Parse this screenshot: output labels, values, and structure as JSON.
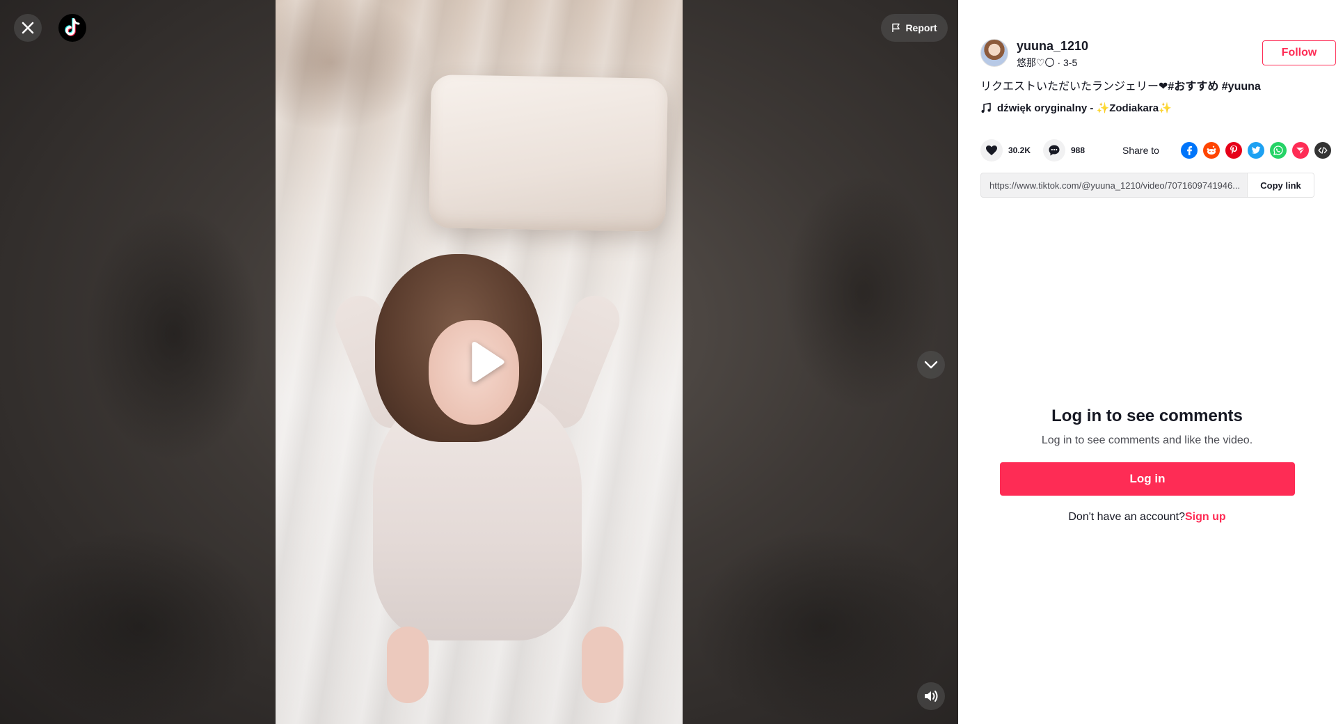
{
  "top_controls": {
    "report_label": "Report"
  },
  "author": {
    "username": "yuuna_1210",
    "nickname": "悠那♡〇",
    "date": "3-5",
    "follow_label": "Follow"
  },
  "post": {
    "caption_text": "リクエストいただいたランジェリー❤︎",
    "hashtags": [
      "#おすすめ",
      "#yuuna"
    ],
    "music": "dźwięk oryginalny - ✨Zodiakara✨"
  },
  "stats": {
    "likes": "30.2K",
    "comments": "988"
  },
  "share": {
    "label": "Share to",
    "targets": [
      "facebook-icon",
      "reddit-icon",
      "pinterest-icon",
      "twitter-icon",
      "whatsapp-icon",
      "telegram-icon",
      "embed-icon"
    ],
    "colors": {
      "facebook": "#0075fa",
      "reddit": "#ff4500",
      "pinterest": "#e60019",
      "twitter": "#1da1f2",
      "whatsapp": "#25d366",
      "telegram": "#fe2c55",
      "embed": "#333333"
    }
  },
  "link": {
    "url": "https://www.tiktok.com/@yuuna_1210/video/7071609741946...",
    "copy_label": "Copy link"
  },
  "login": {
    "title": "Log in to see comments",
    "subtitle": "Log in to see comments and like the video.",
    "button": "Log in",
    "no_account": "Don't have an account?",
    "signup": "Sign up"
  },
  "theme": {
    "accent": "#fe2c55",
    "text": "#161823"
  }
}
